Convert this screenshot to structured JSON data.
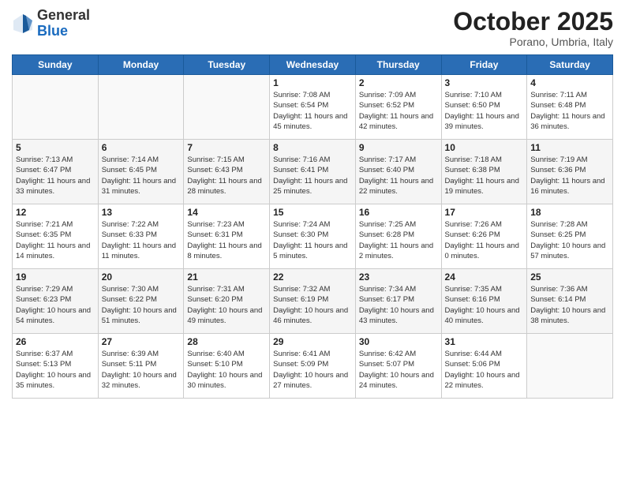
{
  "header": {
    "logo_general": "General",
    "logo_blue": "Blue",
    "month": "October 2025",
    "location": "Porano, Umbria, Italy"
  },
  "weekdays": [
    "Sunday",
    "Monday",
    "Tuesday",
    "Wednesday",
    "Thursday",
    "Friday",
    "Saturday"
  ],
  "weeks": [
    [
      {
        "day": "",
        "info": ""
      },
      {
        "day": "",
        "info": ""
      },
      {
        "day": "",
        "info": ""
      },
      {
        "day": "1",
        "info": "Sunrise: 7:08 AM\nSunset: 6:54 PM\nDaylight: 11 hours and 45 minutes."
      },
      {
        "day": "2",
        "info": "Sunrise: 7:09 AM\nSunset: 6:52 PM\nDaylight: 11 hours and 42 minutes."
      },
      {
        "day": "3",
        "info": "Sunrise: 7:10 AM\nSunset: 6:50 PM\nDaylight: 11 hours and 39 minutes."
      },
      {
        "day": "4",
        "info": "Sunrise: 7:11 AM\nSunset: 6:48 PM\nDaylight: 11 hours and 36 minutes."
      }
    ],
    [
      {
        "day": "5",
        "info": "Sunrise: 7:13 AM\nSunset: 6:47 PM\nDaylight: 11 hours and 33 minutes."
      },
      {
        "day": "6",
        "info": "Sunrise: 7:14 AM\nSunset: 6:45 PM\nDaylight: 11 hours and 31 minutes."
      },
      {
        "day": "7",
        "info": "Sunrise: 7:15 AM\nSunset: 6:43 PM\nDaylight: 11 hours and 28 minutes."
      },
      {
        "day": "8",
        "info": "Sunrise: 7:16 AM\nSunset: 6:41 PM\nDaylight: 11 hours and 25 minutes."
      },
      {
        "day": "9",
        "info": "Sunrise: 7:17 AM\nSunset: 6:40 PM\nDaylight: 11 hours and 22 minutes."
      },
      {
        "day": "10",
        "info": "Sunrise: 7:18 AM\nSunset: 6:38 PM\nDaylight: 11 hours and 19 minutes."
      },
      {
        "day": "11",
        "info": "Sunrise: 7:19 AM\nSunset: 6:36 PM\nDaylight: 11 hours and 16 minutes."
      }
    ],
    [
      {
        "day": "12",
        "info": "Sunrise: 7:21 AM\nSunset: 6:35 PM\nDaylight: 11 hours and 14 minutes."
      },
      {
        "day": "13",
        "info": "Sunrise: 7:22 AM\nSunset: 6:33 PM\nDaylight: 11 hours and 11 minutes."
      },
      {
        "day": "14",
        "info": "Sunrise: 7:23 AM\nSunset: 6:31 PM\nDaylight: 11 hours and 8 minutes."
      },
      {
        "day": "15",
        "info": "Sunrise: 7:24 AM\nSunset: 6:30 PM\nDaylight: 11 hours and 5 minutes."
      },
      {
        "day": "16",
        "info": "Sunrise: 7:25 AM\nSunset: 6:28 PM\nDaylight: 11 hours and 2 minutes."
      },
      {
        "day": "17",
        "info": "Sunrise: 7:26 AM\nSunset: 6:26 PM\nDaylight: 11 hours and 0 minutes."
      },
      {
        "day": "18",
        "info": "Sunrise: 7:28 AM\nSunset: 6:25 PM\nDaylight: 10 hours and 57 minutes."
      }
    ],
    [
      {
        "day": "19",
        "info": "Sunrise: 7:29 AM\nSunset: 6:23 PM\nDaylight: 10 hours and 54 minutes."
      },
      {
        "day": "20",
        "info": "Sunrise: 7:30 AM\nSunset: 6:22 PM\nDaylight: 10 hours and 51 minutes."
      },
      {
        "day": "21",
        "info": "Sunrise: 7:31 AM\nSunset: 6:20 PM\nDaylight: 10 hours and 49 minutes."
      },
      {
        "day": "22",
        "info": "Sunrise: 7:32 AM\nSunset: 6:19 PM\nDaylight: 10 hours and 46 minutes."
      },
      {
        "day": "23",
        "info": "Sunrise: 7:34 AM\nSunset: 6:17 PM\nDaylight: 10 hours and 43 minutes."
      },
      {
        "day": "24",
        "info": "Sunrise: 7:35 AM\nSunset: 6:16 PM\nDaylight: 10 hours and 40 minutes."
      },
      {
        "day": "25",
        "info": "Sunrise: 7:36 AM\nSunset: 6:14 PM\nDaylight: 10 hours and 38 minutes."
      }
    ],
    [
      {
        "day": "26",
        "info": "Sunrise: 6:37 AM\nSunset: 5:13 PM\nDaylight: 10 hours and 35 minutes."
      },
      {
        "day": "27",
        "info": "Sunrise: 6:39 AM\nSunset: 5:11 PM\nDaylight: 10 hours and 32 minutes."
      },
      {
        "day": "28",
        "info": "Sunrise: 6:40 AM\nSunset: 5:10 PM\nDaylight: 10 hours and 30 minutes."
      },
      {
        "day": "29",
        "info": "Sunrise: 6:41 AM\nSunset: 5:09 PM\nDaylight: 10 hours and 27 minutes."
      },
      {
        "day": "30",
        "info": "Sunrise: 6:42 AM\nSunset: 5:07 PM\nDaylight: 10 hours and 24 minutes."
      },
      {
        "day": "31",
        "info": "Sunrise: 6:44 AM\nSunset: 5:06 PM\nDaylight: 10 hours and 22 minutes."
      },
      {
        "day": "",
        "info": ""
      }
    ]
  ]
}
